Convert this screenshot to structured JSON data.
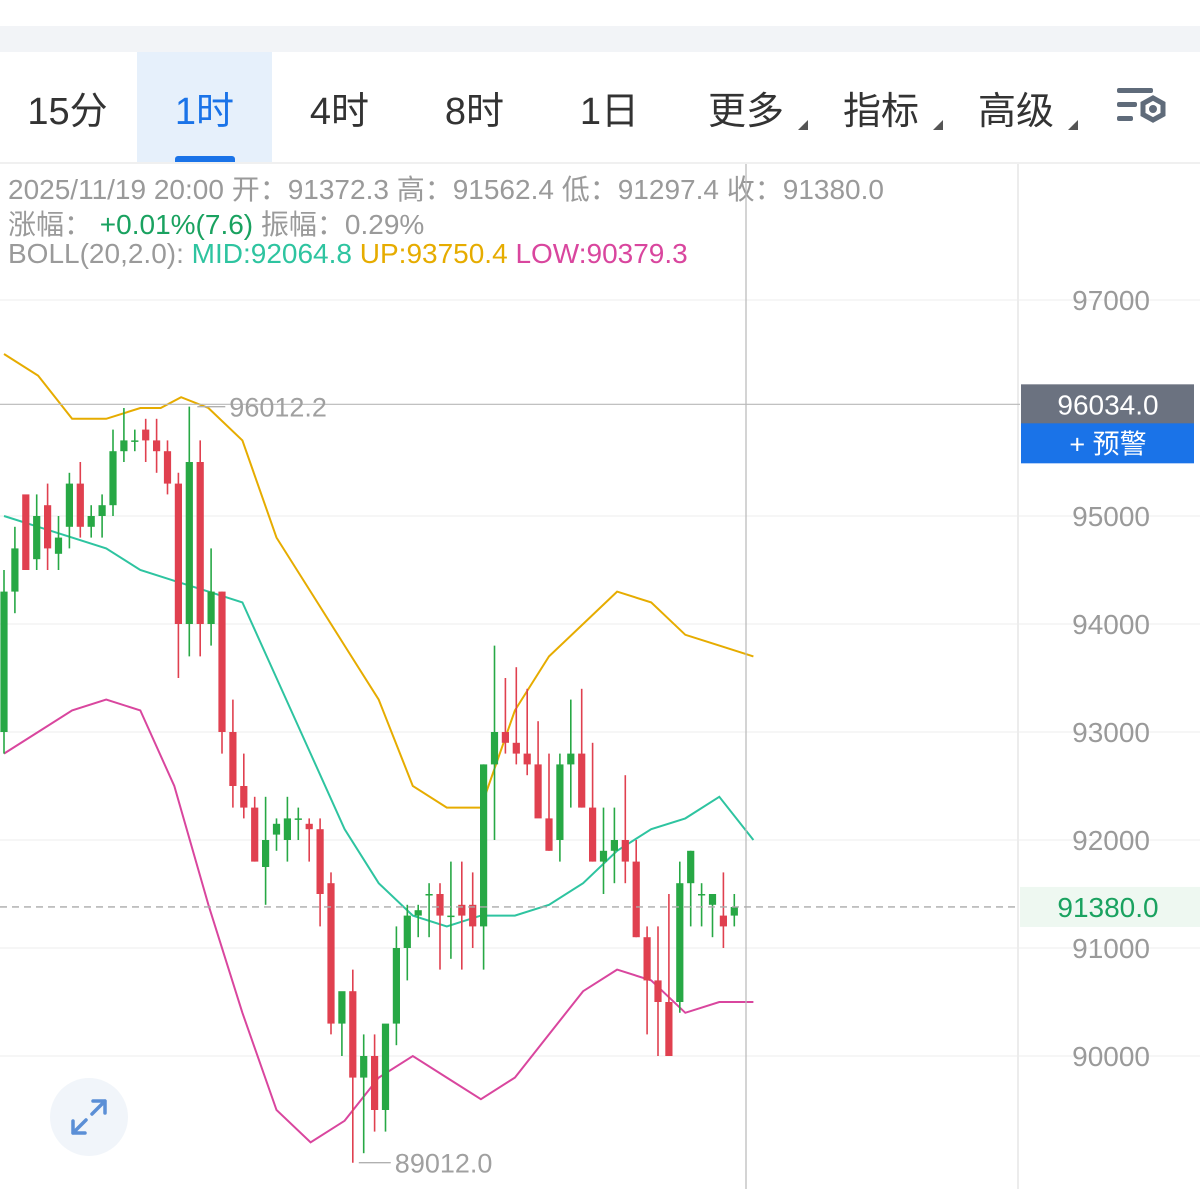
{
  "tabs": [
    {
      "label": "15分",
      "active": false,
      "dropdown": false
    },
    {
      "label": "1时",
      "active": true,
      "dropdown": false
    },
    {
      "label": "4时",
      "active": false,
      "dropdown": false
    },
    {
      "label": "8时",
      "active": false,
      "dropdown": false
    },
    {
      "label": "1日",
      "active": false,
      "dropdown": false
    },
    {
      "label": "更多",
      "active": false,
      "dropdown": true
    },
    {
      "label": "指标",
      "active": false,
      "dropdown": true
    },
    {
      "label": "高级",
      "active": false,
      "dropdown": true
    }
  ],
  "settings_icon": "chart-settings-icon",
  "info": {
    "datetime": "2025/11/19 20:00",
    "open_label": "开：",
    "open": "91372.3",
    "high_label": "高：",
    "high": "91562.4",
    "low_label": "低：",
    "low": "91297.4",
    "close_label": "收：",
    "close": "91380.0",
    "change_label": "涨幅：",
    "change": "+0.01%(7.6)",
    "amplitude_label": "振幅：",
    "amplitude": "0.29%",
    "boll_label": "BOLL(20,2.0):",
    "mid": "MID:92064.8",
    "up": "UP:93750.4",
    "low_band": "LOW:90379.3"
  },
  "price_tags": {
    "crosshair_price": "96034.0",
    "alert_label": "+ 预警",
    "last_price": "91380.0",
    "max_label": "96012.2",
    "min_label": "89012.0"
  },
  "colors": {
    "up": "#27a845",
    "down": "#e0404f",
    "mid": "#2ec4a0",
    "upper": "#e6ac00",
    "lower": "#d9469e",
    "accent": "#1a73e8",
    "crosshair_tag": "#6b7280"
  },
  "chart_data": {
    "type": "candlestick",
    "interval": "1时",
    "y_ticks": [
      97000,
      95000,
      94000,
      93000,
      92000,
      91000,
      90000
    ],
    "ylim": [
      88870,
      97115
    ],
    "crosshair_price": 96034.0,
    "last_price": 91380.0,
    "max_price": 96012.2,
    "min_price": 89012.0,
    "candles": [
      [
        93000,
        94300,
        94500,
        92800
      ],
      [
        94300,
        94700,
        94900,
        94100
      ],
      [
        95200,
        94500,
        94900,
        94700
      ],
      [
        94600,
        95000,
        95200,
        94500
      ],
      [
        95100,
        94700,
        95300,
        94500
      ],
      [
        94650,
        94800,
        95000,
        94500
      ],
      [
        94900,
        95300,
        95400,
        94700
      ],
      [
        95300,
        94900,
        95500,
        94800
      ],
      [
        94900,
        95000,
        95100,
        94800
      ],
      [
        95000,
        95100,
        95200,
        94800
      ],
      [
        95100,
        95600,
        95800,
        95000
      ],
      [
        95600,
        95700,
        96000,
        95500
      ],
      [
        95700,
        95700,
        95800,
        95600
      ],
      [
        95800,
        95700,
        95900,
        95500
      ],
      [
        95700,
        95600,
        95900,
        95400
      ],
      [
        95600,
        95300,
        95700,
        95200
      ],
      [
        95300,
        94000,
        95400,
        93500
      ],
      [
        94000,
        95500,
        96012.2,
        93700
      ],
      [
        95500,
        94000,
        95700,
        93700
      ],
      [
        94000,
        94300,
        94700,
        93800
      ],
      [
        94300,
        93000,
        94300,
        92800
      ],
      [
        93000,
        92500,
        93300,
        92300
      ],
      [
        92500,
        92300,
        92800,
        92200
      ],
      [
        92300,
        91800,
        92400,
        91800
      ],
      [
        91750,
        92000,
        92400,
        91400
      ],
      [
        92050,
        92150,
        92200,
        91900
      ],
      [
        92000,
        92200,
        92400,
        91800
      ],
      [
        92200,
        92200,
        92300,
        92000
      ],
      [
        92150,
        92100,
        92200,
        91800
      ],
      [
        92100,
        91500,
        92200,
        91200
      ],
      [
        91600,
        90300,
        91700,
        90200
      ],
      [
        90300,
        90600,
        90400,
        90000
      ],
      [
        90600,
        89800,
        90800,
        89012
      ],
      [
        89800,
        90000,
        90200,
        89100
      ],
      [
        90000,
        89500,
        90200,
        89300
      ],
      [
        89500,
        90300,
        90200,
        89300
      ],
      [
        90300,
        91000,
        91200,
        90100
      ],
      [
        91000,
        91300,
        91400,
        90700
      ],
      [
        91300,
        91350,
        91400,
        91100
      ],
      [
        91500,
        91500,
        91600,
        91100
      ],
      [
        91500,
        91300,
        91600,
        90800
      ],
      [
        91300,
        91300,
        91800,
        90900
      ],
      [
        91400,
        91300,
        91800,
        90800
      ],
      [
        91400,
        91200,
        91700,
        91000
      ],
      [
        91200,
        92700,
        92700,
        90800
      ],
      [
        92700,
        93000,
        93800,
        92000
      ],
      [
        93000,
        92900,
        93500,
        92800
      ],
      [
        92900,
        92800,
        93600,
        92700
      ],
      [
        92800,
        92700,
        93400,
        92600
      ],
      [
        92700,
        92200,
        93100,
        92300
      ],
      [
        92200,
        91900,
        92800,
        91900
      ],
      [
        92000,
        92700,
        92800,
        91800
      ],
      [
        92700,
        92800,
        93300,
        92300
      ],
      [
        92800,
        92300,
        93400,
        92300
      ],
      [
        92300,
        91800,
        92900,
        91800
      ],
      [
        91800,
        91900,
        92300,
        91500
      ],
      [
        91900,
        92000,
        92300,
        91600
      ],
      [
        92000,
        91800,
        92600,
        91600
      ],
      [
        91800,
        91100,
        92000,
        91100
      ],
      [
        91100,
        90700,
        91200,
        90200
      ],
      [
        90700,
        90500,
        91200,
        90000
      ],
      [
        90500,
        90000,
        91500,
        90300
      ],
      [
        90500,
        91600,
        91800,
        90400
      ],
      [
        91600,
        91900,
        91900,
        91200
      ],
      [
        91500,
        91500,
        91600,
        91200
      ],
      [
        91400,
        91500,
        91500,
        91100
      ],
      [
        91300,
        91200,
        91700,
        91000
      ],
      [
        91300,
        91380,
        91500,
        91200
      ]
    ],
    "boll_upper_path": [
      [
        0,
        96500
      ],
      [
        5,
        96300
      ],
      [
        10,
        95900
      ],
      [
        15,
        95900
      ],
      [
        20,
        96000
      ],
      [
        23,
        96000
      ],
      [
        26,
        96100
      ],
      [
        30,
        96000
      ],
      [
        35,
        95700
      ],
      [
        40,
        94800
      ],
      [
        45,
        94300
      ],
      [
        50,
        93800
      ],
      [
        55,
        93300
      ],
      [
        60,
        92500
      ],
      [
        65,
        92300
      ],
      [
        70,
        92300
      ],
      [
        75,
        93200
      ],
      [
        80,
        93700
      ],
      [
        85,
        94000
      ],
      [
        90,
        94300
      ],
      [
        95,
        94200
      ],
      [
        100,
        93900
      ],
      [
        105,
        93800
      ],
      [
        110,
        93700
      ]
    ],
    "boll_mid_path": [
      [
        0,
        95000
      ],
      [
        5,
        94900
      ],
      [
        10,
        94800
      ],
      [
        15,
        94700
      ],
      [
        20,
        94500
      ],
      [
        25,
        94400
      ],
      [
        30,
        94300
      ],
      [
        35,
        94200
      ],
      [
        40,
        93500
      ],
      [
        45,
        92800
      ],
      [
        50,
        92100
      ],
      [
        55,
        91600
      ],
      [
        60,
        91300
      ],
      [
        65,
        91200
      ],
      [
        70,
        91300
      ],
      [
        75,
        91300
      ],
      [
        80,
        91400
      ],
      [
        85,
        91600
      ],
      [
        90,
        91900
      ],
      [
        95,
        92100
      ],
      [
        100,
        92200
      ],
      [
        105,
        92400
      ],
      [
        110,
        92000
      ]
    ],
    "boll_lower_path": [
      [
        0,
        92800
      ],
      [
        5,
        93000
      ],
      [
        10,
        93200
      ],
      [
        15,
        93300
      ],
      [
        20,
        93200
      ],
      [
        25,
        92500
      ],
      [
        30,
        91400
      ],
      [
        35,
        90400
      ],
      [
        40,
        89500
      ],
      [
        45,
        89200
      ],
      [
        50,
        89400
      ],
      [
        55,
        89800
      ],
      [
        60,
        90000
      ],
      [
        65,
        89800
      ],
      [
        70,
        89600
      ],
      [
        75,
        89800
      ],
      [
        80,
        90200
      ],
      [
        85,
        90600
      ],
      [
        90,
        90800
      ],
      [
        95,
        90700
      ],
      [
        100,
        90400
      ],
      [
        105,
        90500
      ],
      [
        110,
        90500
      ]
    ]
  },
  "expand_icon": "expand-arrows-icon"
}
